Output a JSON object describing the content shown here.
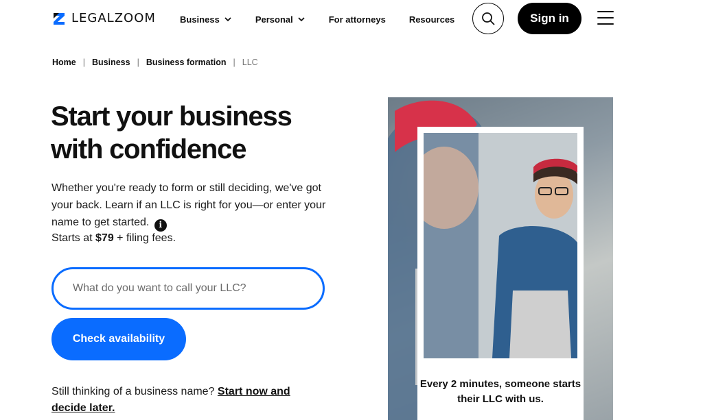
{
  "header": {
    "logo_text": "LEGALZOOM",
    "nav": [
      {
        "label": "Business",
        "has_dropdown": true
      },
      {
        "label": "Personal",
        "has_dropdown": true
      },
      {
        "label": "For attorneys",
        "has_dropdown": false
      },
      {
        "label": "Resources",
        "has_dropdown": false
      }
    ],
    "sign_in_label": "Sign in",
    "icons": {
      "search": "search-icon",
      "menu": "hamburger-menu-icon",
      "logo": "legalzoom-z-logo"
    }
  },
  "breadcrumb": [
    "Home",
    "Business",
    "Business formation",
    "LLC"
  ],
  "hero": {
    "title": "Start your business with confidence",
    "description": "Whether you're ready to form or still deciding, we've got your back. Learn if an LLC is right for you—or enter your name to get started.",
    "price_prefix": "Starts at ",
    "price": "$79",
    "price_suffix": " + filing fees.",
    "input_placeholder": "What do you want to call your LLC?",
    "input_value": "",
    "cta_label": "Check availability",
    "still_text": "Still thinking of a business name? ",
    "still_link": "Start now and decide later."
  },
  "photo": {
    "caption": "Every 2 minutes, someone starts their LLC with us."
  },
  "colors": {
    "accent": "#0a6cff",
    "signin_bg": "#000000",
    "text": "#111111"
  }
}
